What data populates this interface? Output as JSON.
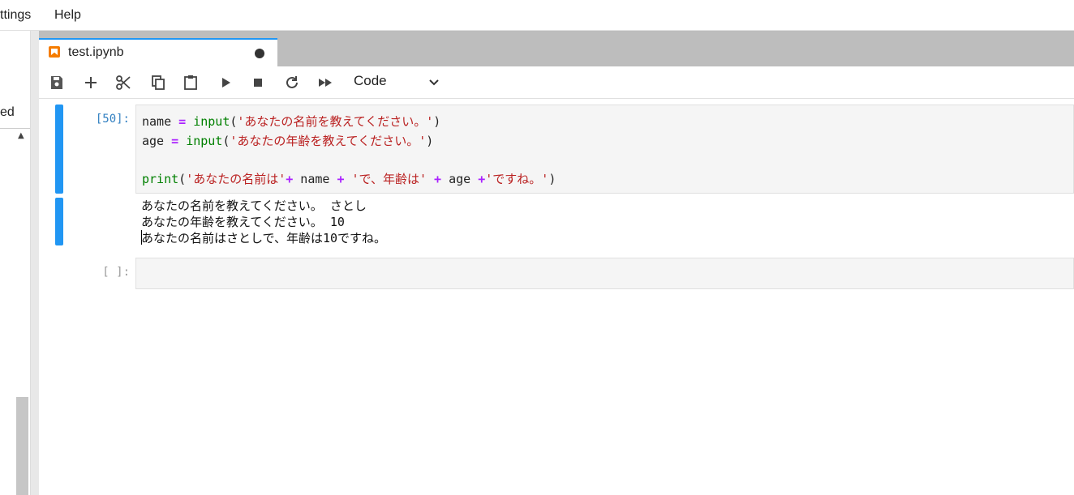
{
  "menu": {
    "items": [
      "ttings",
      "Help"
    ]
  },
  "sidebar": {
    "label": "ed"
  },
  "tab": {
    "title": "test.ipynb"
  },
  "toolbar": {
    "buttons": [
      "save-icon",
      "plus-icon",
      "cut-icon",
      "copy-icon",
      "paste-icon",
      "run-icon",
      "stop-icon",
      "restart-icon",
      "fast-forward-icon"
    ],
    "cell_type": "Code"
  },
  "cells": [
    {
      "prompt": "[50]:",
      "code": [
        {
          "parts": [
            {
              "t": "name ",
              "c": ""
            },
            {
              "t": "=",
              "c": "op"
            },
            {
              "t": " ",
              "c": ""
            },
            {
              "t": "input",
              "c": "kw-builtin"
            },
            {
              "t": "(",
              "c": ""
            },
            {
              "t": "'あなたの名前を教えてください。'",
              "c": "str"
            },
            {
              "t": ")",
              "c": ""
            }
          ]
        },
        {
          "parts": [
            {
              "t": "age ",
              "c": ""
            },
            {
              "t": "=",
              "c": "op"
            },
            {
              "t": " ",
              "c": ""
            },
            {
              "t": "input",
              "c": "kw-builtin"
            },
            {
              "t": "(",
              "c": ""
            },
            {
              "t": "'あなたの年齢を教えてください。'",
              "c": "str"
            },
            {
              "t": ")",
              "c": ""
            }
          ]
        },
        {
          "parts": []
        },
        {
          "parts": [
            {
              "t": "print",
              "c": "kw-builtin"
            },
            {
              "t": "(",
              "c": ""
            },
            {
              "t": "'あなたの名前は'",
              "c": "str"
            },
            {
              "t": "+",
              "c": "op"
            },
            {
              "t": " name ",
              "c": ""
            },
            {
              "t": "+",
              "c": "op"
            },
            {
              "t": " ",
              "c": ""
            },
            {
              "t": "'で、年齢は'",
              "c": "str"
            },
            {
              "t": " ",
              "c": ""
            },
            {
              "t": "+",
              "c": "op"
            },
            {
              "t": " age ",
              "c": ""
            },
            {
              "t": "+",
              "c": "op"
            },
            {
              "t": "'ですね。'",
              "c": "str"
            },
            {
              "t": ")",
              "c": ""
            }
          ]
        }
      ],
      "output": [
        "あなたの名前を教えてください。 さとし",
        "あなたの年齢を教えてください。 10",
        "あなたの名前はさとしで、年齢は10ですね。"
      ]
    },
    {
      "prompt": "[ ]:",
      "code": [],
      "output": []
    }
  ],
  "colors": {
    "accent": "#2196f3",
    "tab_bar": "#bdbdbd",
    "code_bg": "#f5f5f5"
  }
}
